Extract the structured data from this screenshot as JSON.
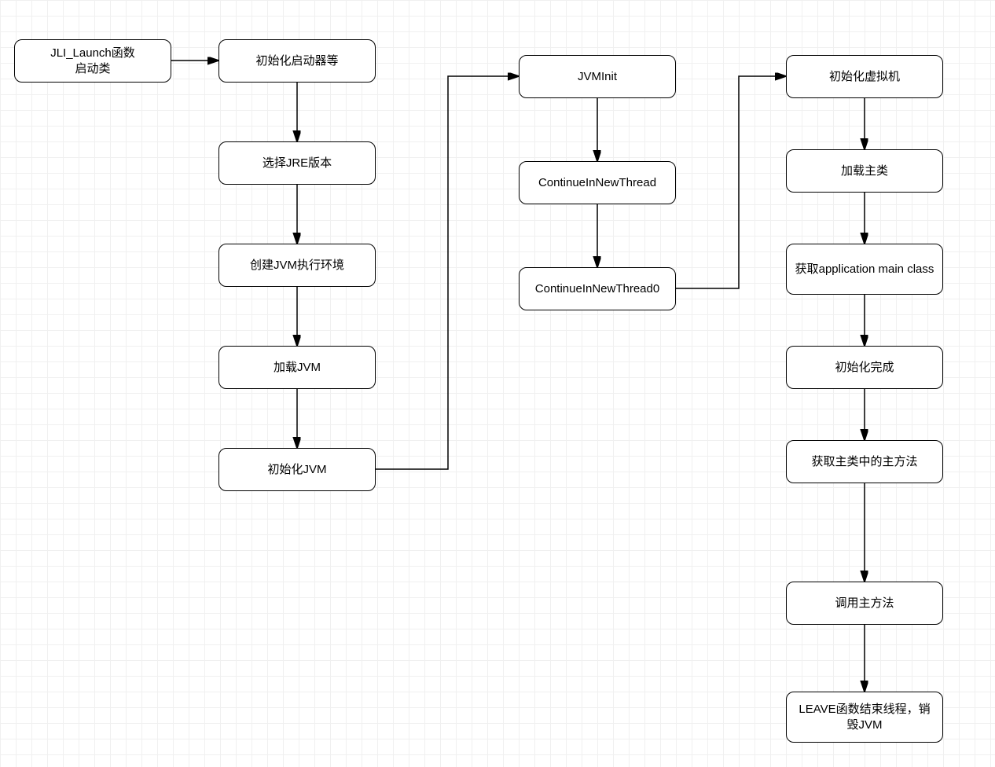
{
  "nodes": {
    "n1": "JLI_Launch函数\n启动类",
    "n2": "初始化启动器等",
    "n3": "选择JRE版本",
    "n4": "创建JVM执行环境",
    "n5": "加载JVM",
    "n6": "初始化JVM",
    "n7": "JVMInit",
    "n8": "ContinueInNewThread",
    "n9": "ContinueInNewThread0",
    "n10": "初始化虚拟机",
    "n11": "加载主类",
    "n12": "获取application main class",
    "n13": "初始化完成",
    "n14": "获取主类中的主方法",
    "n15": "调用主方法",
    "n16": "LEAVE函数结束线程，销毁JVM"
  }
}
